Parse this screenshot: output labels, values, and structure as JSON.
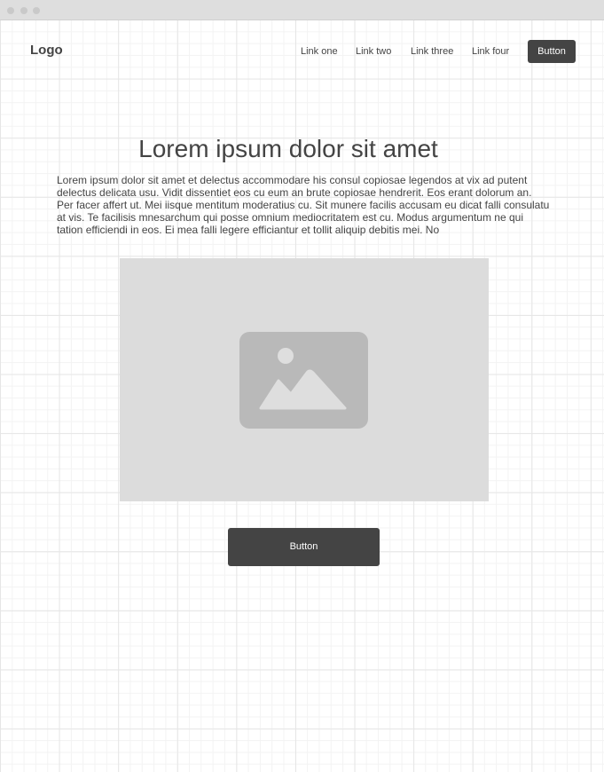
{
  "header": {
    "logo": "Logo",
    "nav_links": [
      "Link one",
      "Link two",
      "Link three",
      "Link four"
    ],
    "button_label": "Button"
  },
  "main": {
    "headline": "Lorem ipsum dolor sit amet",
    "paragraph": "Lorem ipsum dolor sit amet et delectus accommodare his consul copiosae legendos at vix ad putent delectus delicata usu. Vidit dissentiet eos cu eum an brute copiosae hendrerit. Eos erant dolorum an. Per facer affert ut. Mei iisque mentitum moderatius cu. Sit munere facilis accusam eu dicat falli consulatu at vis. Te facilisis mnesarchum qui posse omnium mediocritatem est cu. Modus argumentum ne qui tation efficiendi in eos. Ei mea falli legere efficiantur et tollit aliquip debitis mei. No",
    "image_icon": "image-placeholder-icon",
    "button_label": "Button"
  },
  "colors": {
    "dark": "#444444",
    "placeholder": "#dcdcdc",
    "icon": "#b9b9b9"
  }
}
